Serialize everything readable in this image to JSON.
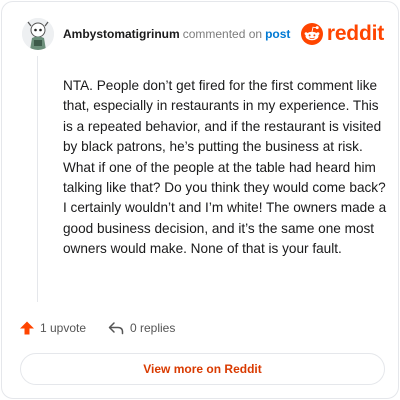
{
  "comment": {
    "author": "Ambystomatigrinum",
    "action": "commented on",
    "target_link": "post",
    "body": "NTA. People don’t get fired for the first comment like that, especially in restaurants in my experience. This is a repeated behavior, and if the restaurant is visited by black patrons, he’s putting the business at risk. What if one of the people at the table had heard him talking like that? Do you think they would come back? I certainly wouldn’t and I’m white! The owners made a good business decision, and it’s the same one most owners would make. None of that is your fault."
  },
  "brand": {
    "name": "reddit",
    "logo_icon": "reddit-snoo-icon",
    "color": "#ff4500"
  },
  "footer": {
    "upvotes": "1 upvote",
    "replies": "0 replies",
    "upvote_icon": "upvote-arrow-icon",
    "reply_icon": "reply-arrow-icon",
    "upvote_color": "#ff4500"
  },
  "cta": {
    "label": "View more on Reddit",
    "color": "#d93a00"
  }
}
